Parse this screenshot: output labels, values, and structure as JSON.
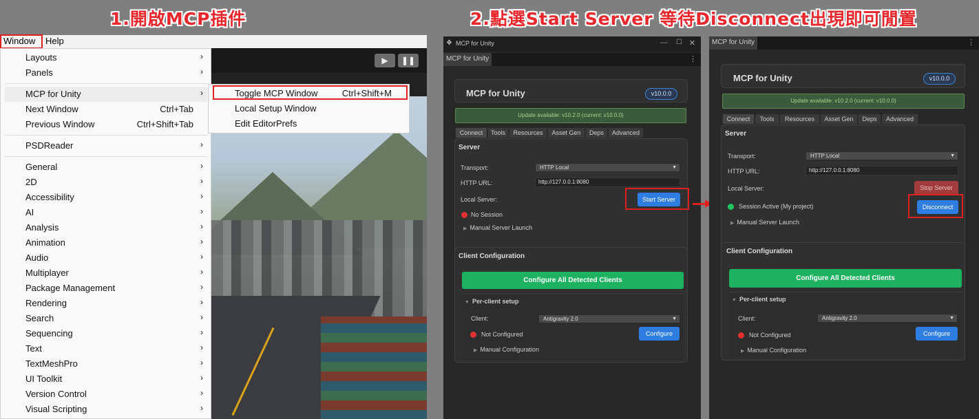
{
  "headings": {
    "step1": "1.開啟MCP插件",
    "step2": "2.點選Start Server  等待Disconnect出現即可閒置"
  },
  "menubar": {
    "window": "Window",
    "help": "Help"
  },
  "window_menu": {
    "group1": [
      {
        "label": "Layouts",
        "arrow": "›"
      },
      {
        "label": "Panels",
        "arrow": "›"
      }
    ],
    "group2": [
      {
        "label": "MCP for Unity",
        "arrow": "›"
      },
      {
        "label": "Next Window",
        "shortcut": "Ctrl+Tab"
      },
      {
        "label": "Previous Window",
        "shortcut": "Ctrl+Shift+Tab"
      }
    ],
    "group3": [
      {
        "label": "PSDReader",
        "arrow": "›"
      }
    ],
    "group4": [
      {
        "label": "General",
        "arrow": "›"
      },
      {
        "label": "2D",
        "arrow": "›"
      },
      {
        "label": "Accessibility",
        "arrow": "›"
      },
      {
        "label": "AI",
        "arrow": "›"
      },
      {
        "label": "Analysis",
        "arrow": "›"
      },
      {
        "label": "Animation",
        "arrow": "›"
      },
      {
        "label": "Audio",
        "arrow": "›"
      },
      {
        "label": "Multiplayer",
        "arrow": "›"
      },
      {
        "label": "Package Management",
        "arrow": "›"
      },
      {
        "label": "Rendering",
        "arrow": "›"
      },
      {
        "label": "Search",
        "arrow": "›"
      },
      {
        "label": "Sequencing",
        "arrow": "›"
      },
      {
        "label": "Text",
        "arrow": "›"
      },
      {
        "label": "TextMeshPro",
        "arrow": "›"
      },
      {
        "label": "UI Toolkit",
        "arrow": "›"
      },
      {
        "label": "Version Control",
        "arrow": "›"
      },
      {
        "label": "Visual Scripting",
        "arrow": "›"
      }
    ]
  },
  "mcp_submenu": [
    {
      "label": "Toggle MCP Window",
      "shortcut": "Ctrl+Shift+M"
    },
    {
      "label": "Local Setup Window"
    },
    {
      "label": "Edit EditorPrefs"
    }
  ],
  "scene_toolbar": {
    "play": "▶",
    "pause": "❚❚"
  },
  "window_a": {
    "title": "MCP for Unity",
    "tab": "MCP for Unity",
    "header": "MCP for Unity",
    "version": "v10.0.0",
    "update": "Update available: v10.2.0 (current: v10.0.0)",
    "tabs": [
      "Connect",
      "Tools",
      "Resources",
      "Asset Gen",
      "Deps",
      "Advanced"
    ],
    "server": {
      "title": "Server",
      "transport_label": "Transport:",
      "transport_value": "HTTP Local",
      "url_label": "HTTP URL:",
      "url_value": "http://127.0.0.1:8080",
      "local_label": "Local Server:",
      "button": "Start Server",
      "status": "No Session",
      "manual": "Manual Server Launch"
    },
    "client": {
      "title": "Client Configuration",
      "configure_all": "Configure All Detected Clients",
      "per_client": "Per-client setup",
      "client_label": "Client:",
      "client_value": "Antigravity 2.0",
      "status": "Not Configured",
      "configure": "Configure",
      "manual": "Manual Configuration"
    },
    "status_color": "#e03030"
  },
  "window_b": {
    "tab": "MCP for Unity",
    "header": "MCP for Unity",
    "version": "v10.0.0",
    "update": "Update available: v10.2.0 (current: v10.0.0)",
    "tabs": [
      "Connect",
      "Tools",
      "Resources",
      "Asset Gen",
      "Deps",
      "Advanced"
    ],
    "server": {
      "title": "Server",
      "transport_label": "Transport:",
      "transport_value": "HTTP Local",
      "url_label": "HTTP URL:",
      "url_value": "http://127.0.0.1:8080",
      "local_label": "Local Server:",
      "stop_button": "Stop Server",
      "status": "Session Active (My project)",
      "button": "Disconnect",
      "manual": "Manual Server Launch"
    },
    "client": {
      "title": "Client Configuration",
      "configure_all": "Configure All Detected Clients",
      "per_client": "Per-client setup",
      "client_label": "Client:",
      "client_value": "Antigravity 2.0",
      "status": "Not Configured",
      "configure": "Configure",
      "manual": "Manual Configuration"
    },
    "status_color": "#22c55e"
  },
  "colors": {
    "highlight": "#e02020",
    "accent_blue": "#2d7ee0",
    "accent_green": "#1db260"
  }
}
